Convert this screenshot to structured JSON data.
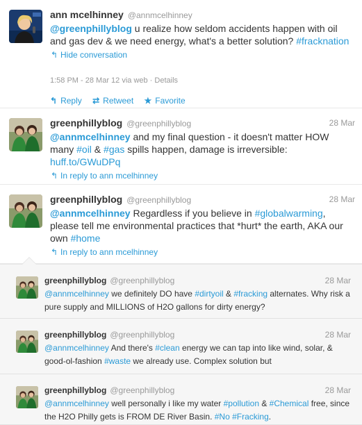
{
  "tweets": [
    {
      "id": "t1",
      "name": "ann mcelhinney",
      "screen": "@annmcelhinney",
      "segments": [
        {
          "t": "@greenphillyblog",
          "link": true,
          "bold": true
        },
        {
          "t": " u realize how seldom accidents happen with oil and gas dev & we need energy, what's a better solution? ",
          "link": false
        },
        {
          "t": "#fracknation",
          "link": true
        }
      ],
      "sub_label": "Hide conversation",
      "meta": "1:58 PM - 28 Mar 12 via web · Details",
      "actions": {
        "reply": "Reply",
        "retweet": "Retweet",
        "favorite": "Favorite"
      }
    },
    {
      "id": "t2",
      "name": "greenphillyblog",
      "screen": "@greenphillyblog",
      "date": "28 Mar",
      "segments": [
        {
          "t": "@annmcelhinney",
          "link": true,
          "bold": true
        },
        {
          "t": " and my final question - it doesn't matter HOW many ",
          "link": false
        },
        {
          "t": "#oil",
          "link": true
        },
        {
          "t": " & ",
          "link": false
        },
        {
          "t": "#gas",
          "link": true
        },
        {
          "t": " spills happen, damage is irreversible: ",
          "link": false
        },
        {
          "t": "huff.to/GWuDPq",
          "link": true
        }
      ],
      "sub_label": "In reply to ann mcelhinney"
    },
    {
      "id": "t3",
      "name": "greenphillyblog",
      "screen": "@greenphillyblog",
      "date": "28 Mar",
      "segments": [
        {
          "t": "@annmcelhinney",
          "link": true,
          "bold": true
        },
        {
          "t": " Regardless if you believe in ",
          "link": false
        },
        {
          "t": "#globalwarming",
          "link": true
        },
        {
          "t": ", please tell me environmental practices that *hurt* the earth, AKA our own ",
          "link": false
        },
        {
          "t": "#home",
          "link": true
        }
      ],
      "sub_label": "In reply to ann mcelhinney"
    },
    {
      "id": "t4",
      "name": "greenphillyblog",
      "screen": "@greenphillyblog",
      "date": "28 Mar",
      "segments": [
        {
          "t": "@annmcelhinney",
          "link": true
        },
        {
          "t": " we definitely DO have ",
          "link": false
        },
        {
          "t": "#dirtyoil",
          "link": true
        },
        {
          "t": " & ",
          "link": false
        },
        {
          "t": "#fracking",
          "link": true
        },
        {
          "t": " alternates. Why risk a pure supply and MILLIONS of H2O gallons for dirty energy?",
          "link": false
        }
      ]
    },
    {
      "id": "t5",
      "name": "greenphillyblog",
      "screen": "@greenphillyblog",
      "date": "28 Mar",
      "segments": [
        {
          "t": "@annmcelhinney",
          "link": true
        },
        {
          "t": " And there's ",
          "link": false
        },
        {
          "t": "#clean",
          "link": true
        },
        {
          "t": " energy we can tap into like wind, solar, & good-ol-fashion ",
          "link": false
        },
        {
          "t": "#waste",
          "link": true
        },
        {
          "t": " we already use. Complex solution but",
          "link": false
        }
      ]
    },
    {
      "id": "t6",
      "name": "greenphillyblog",
      "screen": "@greenphillyblog",
      "date": "28 Mar",
      "segments": [
        {
          "t": "@annmcelhinney",
          "link": true
        },
        {
          "t": " well personally i like my water ",
          "link": false
        },
        {
          "t": "#pollution",
          "link": true
        },
        {
          "t": " & ",
          "link": false
        },
        {
          "t": "#Chemical",
          "link": true
        },
        {
          "t": " free, since the H2O Philly gets is FROM DE River Basin. ",
          "link": false
        },
        {
          "t": "#No",
          "link": true
        },
        {
          "t": " ",
          "link": false
        },
        {
          "t": "#Fracking",
          "link": true
        },
        {
          "t": ".",
          "link": false
        }
      ]
    }
  ],
  "colors": {
    "link": "#2a9ad6",
    "text": "#333333",
    "muted": "#999999",
    "nested_bg": "#f6f6f6"
  },
  "icons": {
    "reply": "reply-arrow-icon",
    "retweet": "retweet-icon",
    "favorite": "star-icon"
  }
}
